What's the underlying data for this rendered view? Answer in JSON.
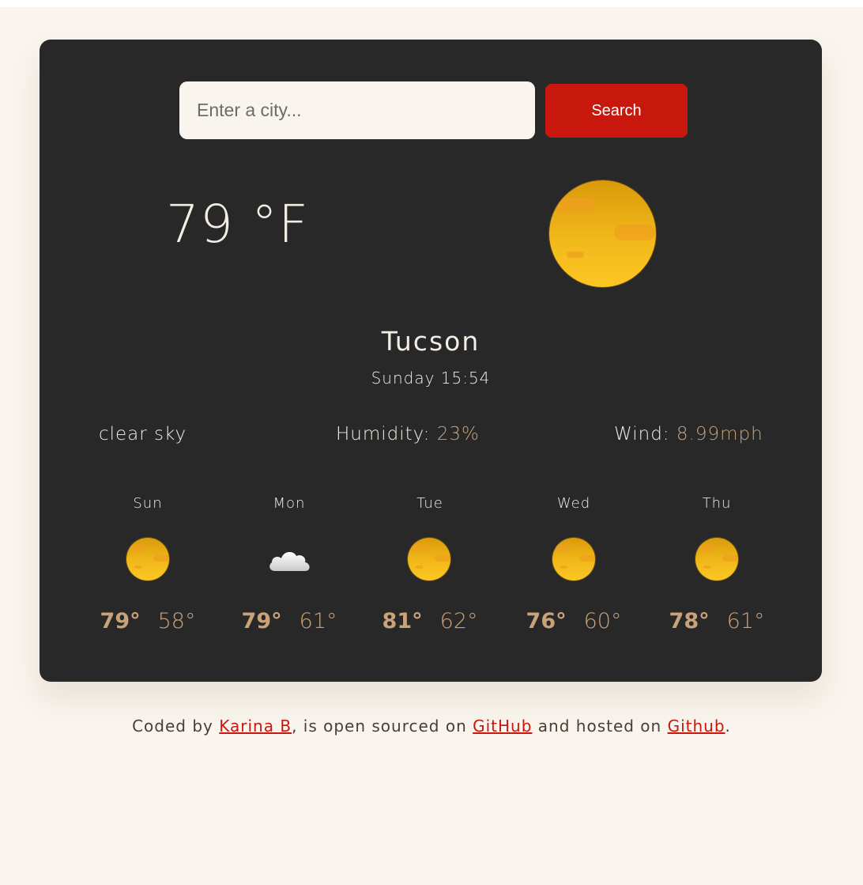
{
  "search": {
    "placeholder": "Enter a city...",
    "button_label": "Search"
  },
  "current": {
    "temperature": "79",
    "unit": "°F",
    "icon": "sun-icon",
    "city": "Tucson",
    "datetime": "Sunday 15:54",
    "description": "clear sky",
    "humidity_label": "Humidity:",
    "humidity_value": "23%",
    "wind_label": "Wind:",
    "wind_value": "8.99mph"
  },
  "forecast": [
    {
      "day": "Sun",
      "icon": "sun-icon",
      "max": "79°",
      "min": "58°"
    },
    {
      "day": "Mon",
      "icon": "cloud-icon",
      "max": "79°",
      "min": "61°"
    },
    {
      "day": "Tue",
      "icon": "sun-icon",
      "max": "81°",
      "min": "62°"
    },
    {
      "day": "Wed",
      "icon": "sun-icon",
      "max": "76°",
      "min": "60°"
    },
    {
      "day": "Thu",
      "icon": "sun-icon",
      "max": "78°",
      "min": "61°"
    }
  ],
  "footer": {
    "prefix": "Coded by ",
    "author": "Karina B",
    "middle1": ", is open sourced on ",
    "repo_link": "GitHub",
    "middle2": " and hosted on ",
    "host_link": "Github",
    "suffix": "."
  },
  "colors": {
    "accent": "#c9a27a",
    "button": "#c8170d",
    "card": "#282828",
    "background": "#f9f4ee"
  }
}
